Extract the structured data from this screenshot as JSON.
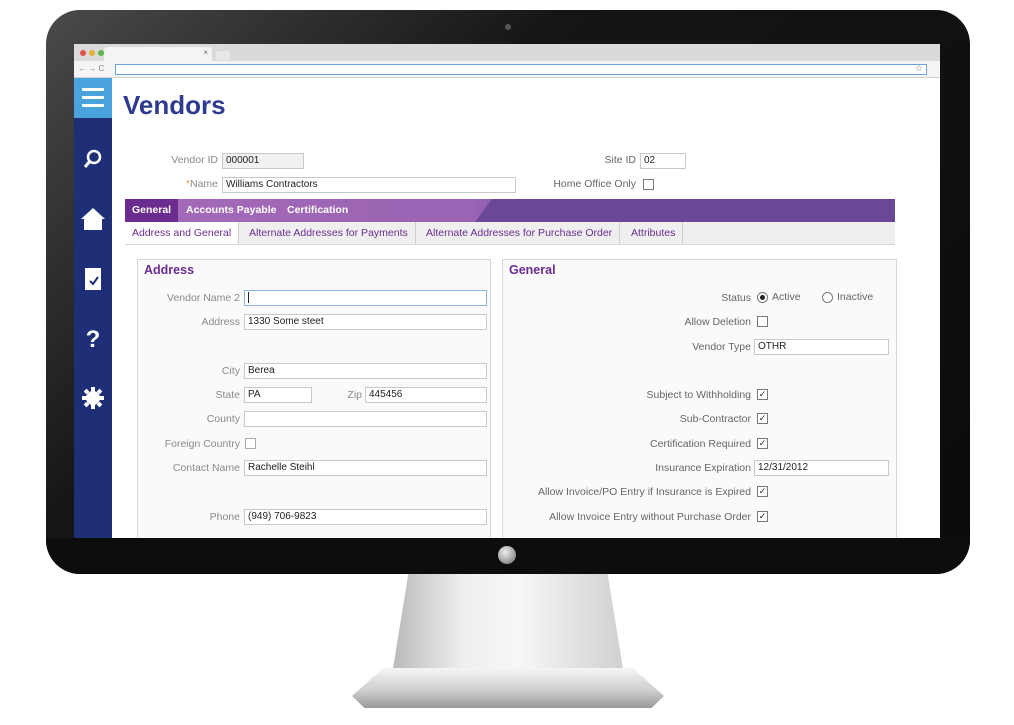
{
  "browser": {
    "tab_close": "×",
    "back_glyph": "← → C",
    "star_glyph": "☆"
  },
  "sidebar": {
    "icons": [
      "menu-icon",
      "search-icon",
      "home-icon",
      "document-check-icon",
      "help-icon",
      "gear-icon"
    ],
    "help_glyph": "?",
    "doc_check": "✓"
  },
  "page": {
    "title": "Vendors"
  },
  "header": {
    "vendor_id_label": "Vendor ID",
    "vendor_id": "000001",
    "name_req": "*",
    "name_label": "Name",
    "name": "Williams Contractors",
    "site_id_label": "Site ID",
    "site_id": "02",
    "home_office_label": "Home Office Only"
  },
  "main_tabs": [
    "General",
    "Accounts Payable",
    "Certification"
  ],
  "sub_tabs": [
    "Address and General",
    "Alternate Addresses for Payments",
    "Alternate Addresses for Purchase Order",
    "Attributes"
  ],
  "address": {
    "title": "Address",
    "vendor_name2_label": "Vendor Name 2",
    "vendor_name2": "",
    "address_label": "Address",
    "address": "1330 Some steet",
    "city_label": "City",
    "city": "Berea",
    "state_label": "State",
    "state": "PA",
    "zip_label": "Zip",
    "zip": "445456",
    "county_label": "County",
    "county": "",
    "foreign_label": "Foreign Country",
    "contact_label": "Contact Name",
    "contact": "Rachelle Steihl",
    "phone_label": "Phone",
    "phone": "(949) 706-9823"
  },
  "general": {
    "title": "General",
    "status_label": "Status",
    "active": "Active",
    "inactive": "Inactive",
    "status": "Active",
    "allow_deletion_label": "Allow Deletion",
    "vendor_type_label": "Vendor Type",
    "vendor_type": "OTHR",
    "withholding_label": "Subject to Withholding",
    "subcontractor_label": "Sub-Contractor",
    "cert_required_label": "Certification Required",
    "insurance_exp_label": "Insurance Expiration",
    "insurance_exp": "12/31/2012",
    "allow_invoice_po_label": "Allow Invoice/PO Entry if Insurance is Expired",
    "allow_invoice_no_po_label": "Allow Invoice Entry without Purchase Order",
    "check_glyph": "✓"
  }
}
